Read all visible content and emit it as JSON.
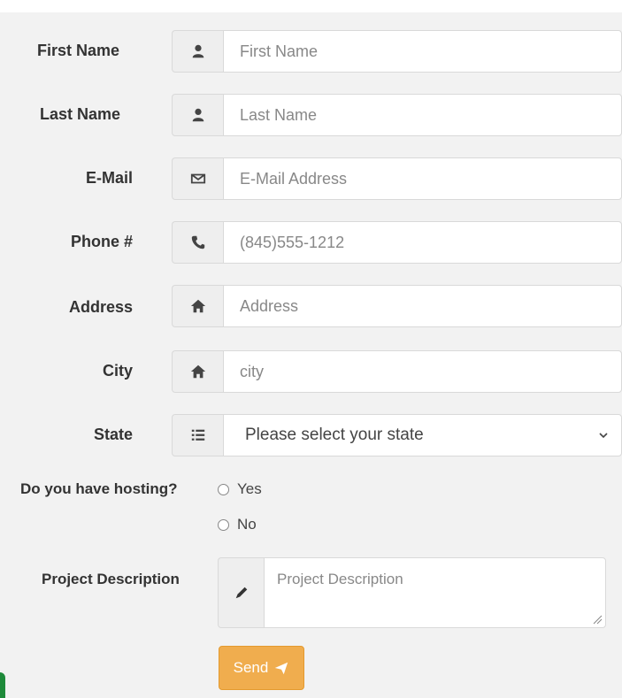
{
  "form": {
    "fields": [
      {
        "label": "First Name",
        "placeholder": "First Name",
        "icon": "user-icon"
      },
      {
        "label": "Last Name",
        "placeholder": "Last Name",
        "icon": "user-icon"
      },
      {
        "label": "E-Mail",
        "placeholder": "E-Mail Address",
        "icon": "envelope-icon"
      },
      {
        "label": "Phone #",
        "placeholder": "(845)555-1212",
        "icon": "phone-icon"
      },
      {
        "label": "Address",
        "placeholder": "Address",
        "icon": "home-icon"
      },
      {
        "label": "City",
        "placeholder": "city",
        "icon": "home-icon"
      }
    ],
    "state": {
      "label": "State",
      "selected": "Please select your state",
      "icon": "list-icon"
    },
    "hosting": {
      "label": "Do you have hosting?",
      "options": [
        "Yes",
        "No"
      ]
    },
    "project": {
      "label": "Project Description",
      "placeholder": "Project Description",
      "icon": "pencil-icon"
    },
    "send_label": "Send"
  },
  "colors": {
    "send_button": "#f0ad4e",
    "panel_background": "#f2f2f2",
    "accent_edge": "#1e8a3a"
  }
}
